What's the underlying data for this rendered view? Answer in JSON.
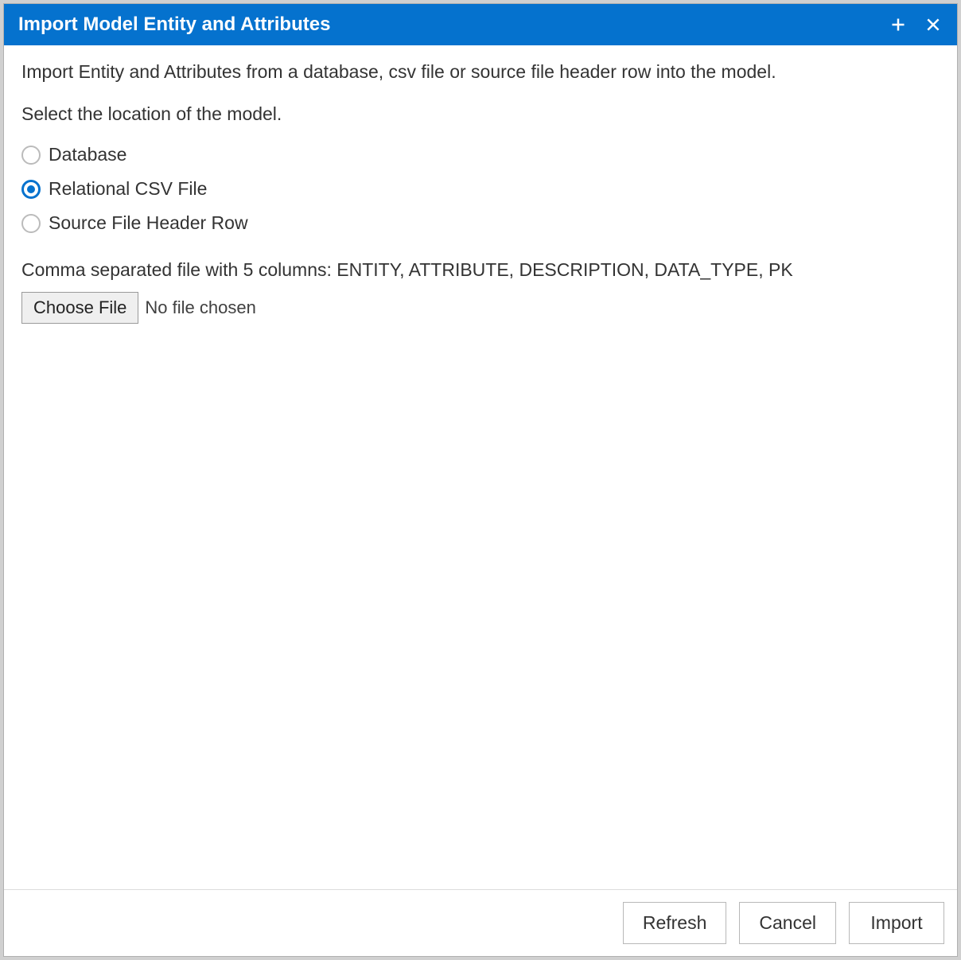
{
  "titlebar": {
    "title": "Import Model Entity and Attributes"
  },
  "content": {
    "intro": "Import Entity and Attributes from a database, csv file or source file header row into the model.",
    "select_label": "Select the location of the model.",
    "options": [
      {
        "label": "Database",
        "selected": false
      },
      {
        "label": "Relational CSV File",
        "selected": true
      },
      {
        "label": "Source File Header Row",
        "selected": false
      }
    ],
    "helper": "Comma separated file with 5 columns: ENTITY, ATTRIBUTE, DESCRIPTION, DATA_TYPE, PK",
    "choose_file_label": "Choose File",
    "file_status": "No file chosen"
  },
  "footer": {
    "refresh": "Refresh",
    "cancel": "Cancel",
    "import": "Import"
  }
}
